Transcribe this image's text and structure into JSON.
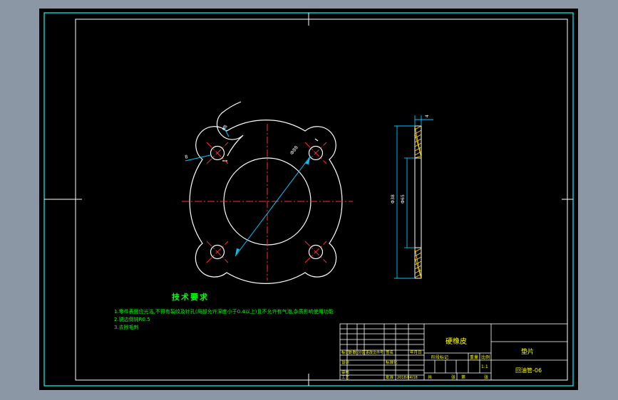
{
  "colors": {
    "background": "#000000",
    "frame": "#00ffff",
    "border": "#ffffff",
    "centerline": "#ff3030",
    "dimension": "#00c8ff",
    "text_green": "#00ff00",
    "text_yellow": "#ffff00",
    "hatch": "#ffd700"
  },
  "front_view": {
    "dim_hole_dia": "8",
    "dim_corner_radius": "R8",
    "dim_pcd": "Ф88"
  },
  "side_view": {
    "dim_thickness": "4",
    "dim_outer": "Ф38",
    "dim_inner": "Ф65"
  },
  "notes": {
    "heading": "技术要求",
    "lines": [
      "1.零件表面应光洁,不得有裂纹及针孔(局部允许深度小于0.4以上)且不允许有气泡,杂质影响使用功能",
      "2.锐边倒钝R0.5",
      "3.去除毛刺"
    ]
  },
  "title_block": {
    "part_name": "硬橡皮",
    "drawing_name": "垫片",
    "drawing_number": "回油管-06",
    "row_labels": [
      "标记",
      "处数",
      "分区",
      "更改文件号",
      "签名",
      "年月日"
    ],
    "roles": [
      "设计",
      "审核",
      "工艺"
    ],
    "standardization": "标准化",
    "approve": "批准",
    "date": "2018/04/18",
    "stage_label": "阶段标记",
    "weight_label": "重量",
    "scale_label": "比例",
    "scale_value": "1:1",
    "sheets_label": "共",
    "sheet_label": "第",
    "sheet_unit": "张"
  }
}
